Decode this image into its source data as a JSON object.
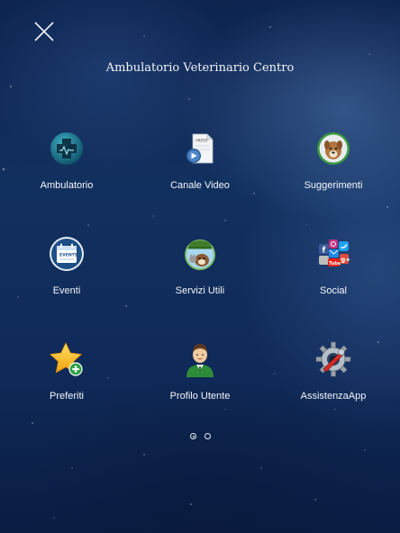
{
  "header": {
    "title": "Ambulatorio Veterinario Centro",
    "close_icon": "close-icon"
  },
  "menu": {
    "items": [
      {
        "label": "Ambulatorio",
        "icon": "medical-cross-icon"
      },
      {
        "label": "Canale Video",
        "icon": "video-file-icon"
      },
      {
        "label": "Suggerimenti",
        "icon": "dog-icon"
      },
      {
        "label": "Eventi",
        "icon": "calendar-events-icon"
      },
      {
        "label": "Servizi Utili",
        "icon": "services-cat-dog-icon"
      },
      {
        "label": "Social",
        "icon": "social-networks-icon"
      },
      {
        "label": "Preferiti",
        "icon": "star-add-icon"
      },
      {
        "label": "Profilo Utente",
        "icon": "user-profile-icon"
      },
      {
        "label": "AssistenzaApp",
        "icon": "gear-tools-icon"
      }
    ]
  },
  "pager": {
    "pages": 2,
    "current": 1
  },
  "colors": {
    "background": "#12305f",
    "text": "#f4f6fa"
  }
}
